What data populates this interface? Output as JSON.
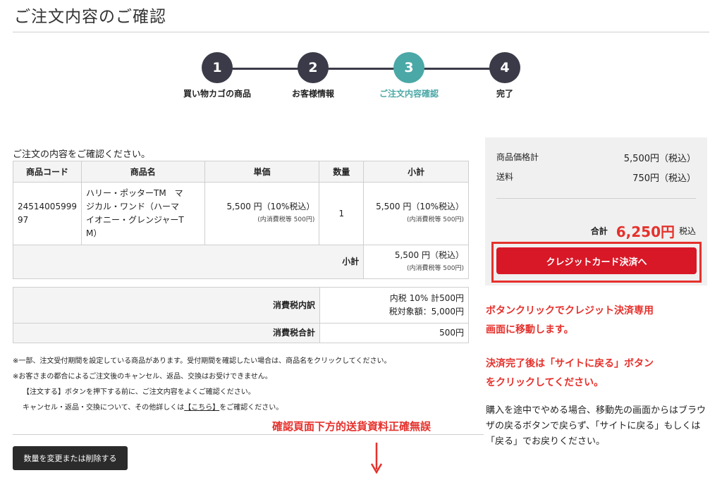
{
  "page": {
    "title": "ご注文内容のご確認"
  },
  "stepper": {
    "steps": [
      {
        "number": "1",
        "label": "買い物カゴの商品"
      },
      {
        "number": "2",
        "label": "お客様情報"
      },
      {
        "number": "3",
        "label": "ご注文内容確認"
      },
      {
        "number": "4",
        "label": "完了"
      }
    ],
    "active_step": 3
  },
  "order": {
    "intro": "ご注文の内容をご確認ください。",
    "headers": {
      "code": "商品コード",
      "name": "商品名",
      "unit_price": "単価",
      "qty": "数量",
      "subtotal": "小計"
    },
    "item": {
      "code_line1": "24514005999",
      "code_line2": "97",
      "name_line1": "ハリー・ポッターTM　マ",
      "name_line2": "ジカル・ワンド（ハーマ",
      "name_line3": "イオニー・グレンジャーT",
      "name_line4": "M）",
      "unit_price": "5,500 円（10%税込）",
      "unit_price_tax": "(内消費税等 500円)",
      "qty": "1",
      "subtotal": "5,500 円（10%税込）",
      "subtotal_tax": "(内消費税等 500円)"
    },
    "subtotal_row": {
      "label": "小計",
      "value": "5,500 円（税込）",
      "tax": "(内消費税等 500円)"
    }
  },
  "tax": {
    "breakdown_label": "消費税内訳",
    "breakdown_value1": "内税 10% 計500円",
    "breakdown_value2": "税対象額：5,000円",
    "total_label": "消費税合計",
    "total_value": "500円"
  },
  "notes": {
    "line1": "※一部、注文受付期間を設定している商品があります。受付期間を確認したい場合は、商品名をクリックしてください。",
    "line2": "※お客さまの都合によるご注文後のキャンセル、返品、交換はお受けできません。",
    "line3": "【注文する】ボタンを押下する前に、ご注文内容をよくご確認ください。",
    "line4_before": "キャンセル・返品・交換について、その他詳しくは",
    "line4_link": "【こちら】",
    "line4_after": "をご確認ください。"
  },
  "actions": {
    "change_button": "数量を変更または削除する",
    "card_button": "クレジットカード決済へ"
  },
  "summary": {
    "item_price_label": "商品価格計",
    "item_price_value": "5,500円（税込）",
    "shipping_label": "送料",
    "shipping_value": "750円（税込）",
    "total_label": "合計",
    "total_value": "6,250円",
    "total_tax_note": "税込"
  },
  "annotations": {
    "zh_note": "確認頁面下方的送貨資料正確無誤",
    "red_line1": "ボタンクリックでクレジット決済専用",
    "red_line2": "画面に移動します。",
    "red_line3": "決済完了後は「サイトに戻る」ボタン",
    "red_line4": "をクリックしてください。",
    "black_text": "購入を途中でやめる場合、移動先の画面からはブラウザの戻るボタンで戻らず、「サイトに戻る」もしくは「戻る」でお戻りください。"
  },
  "colors": {
    "step_dark": "#3a3a48",
    "step_active": "#4aa8a6",
    "accent_red": "#e5312c",
    "card_button": "#d81827"
  }
}
